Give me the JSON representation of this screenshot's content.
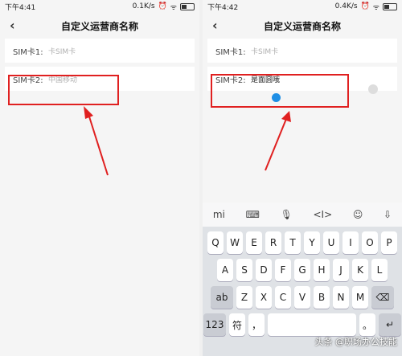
{
  "left": {
    "status": {
      "time": "下午4:41",
      "speed": "0.1K/s"
    },
    "title": "自定义运营商名称",
    "sim1": {
      "label": "SIM卡1:",
      "placeholder": "卡SIM卡"
    },
    "sim2": {
      "label": "SIM卡2:",
      "placeholder": "中国移动"
    }
  },
  "right": {
    "status": {
      "time": "下午4:42",
      "speed": "0.4K/s"
    },
    "title": "自定义运营商名称",
    "sim1": {
      "label": "SIM卡1:",
      "placeholder": "卡SIM卡"
    },
    "sim2": {
      "label": "SIM卡2:",
      "value": "是面圆哦"
    }
  },
  "keyboard": {
    "toolbar": [
      "mi",
      "⌨",
      "🎙",
      "<I>",
      "☺",
      "⇩"
    ],
    "row1": [
      "Q",
      "W",
      "E",
      "R",
      "T",
      "Y",
      "U",
      "I",
      "O",
      "P"
    ],
    "row2": [
      "A",
      "S",
      "D",
      "F",
      "G",
      "H",
      "J",
      "K",
      "L"
    ],
    "row3": [
      "ab",
      "Z",
      "X",
      "C",
      "V",
      "B",
      "N",
      "M",
      "⌫"
    ],
    "row4": [
      "123",
      "符",
      "，",
      "",
      "。",
      "↵"
    ]
  },
  "watermark": "头条 @职场办公技能",
  "colors": {
    "highlight": "#e02020",
    "cursor": "#1f8fe5"
  }
}
